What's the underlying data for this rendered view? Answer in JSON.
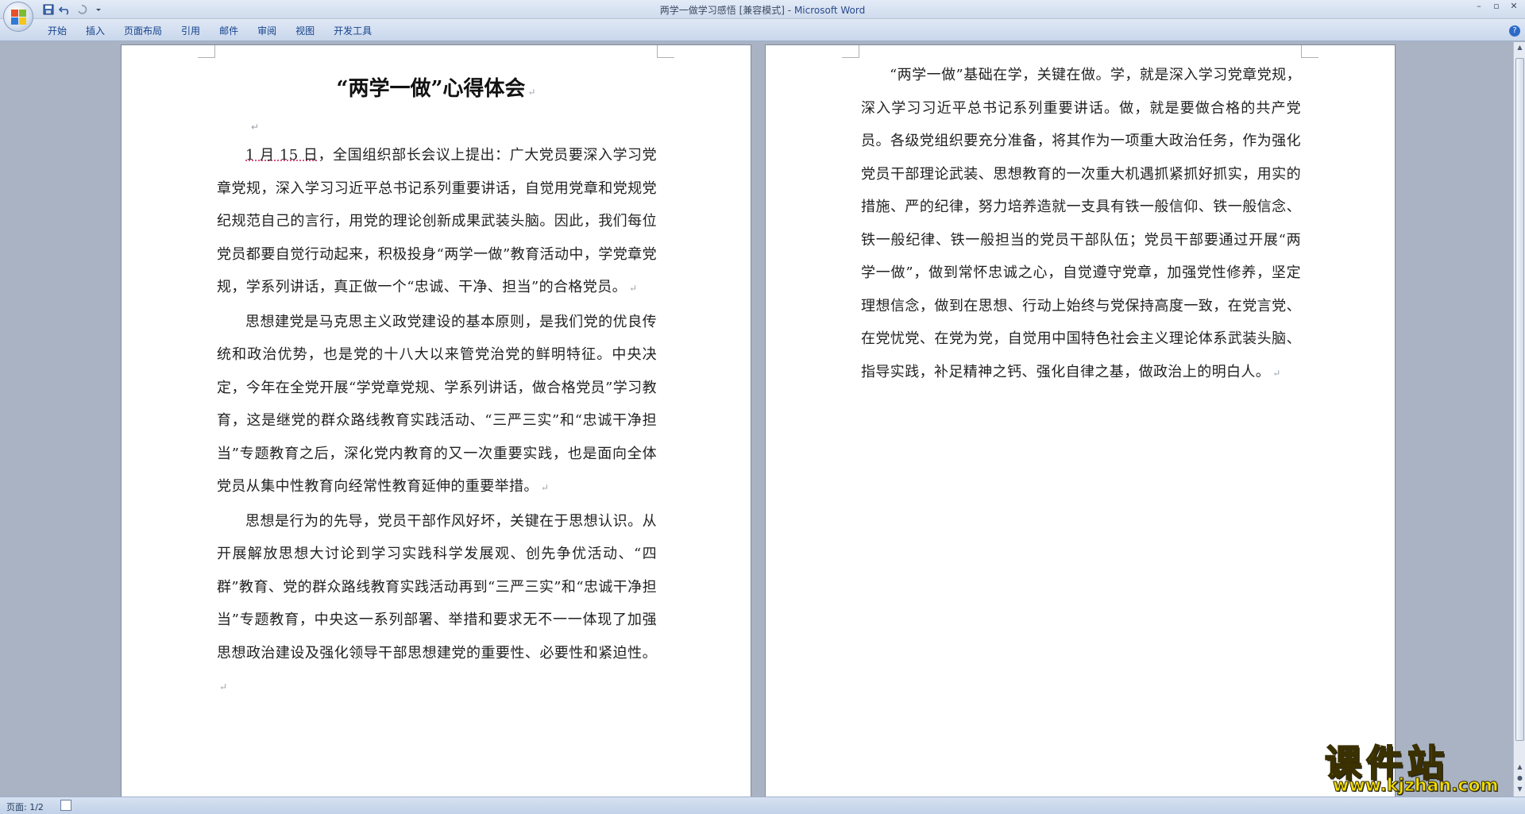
{
  "window": {
    "doc_title": "两学一做学习感悟 [兼容模式]",
    "separator": " - ",
    "app_name": "Microsoft Word",
    "controls": [
      "–",
      "▫",
      "✕"
    ]
  },
  "quick_access": {
    "icons": [
      "save-icon",
      "undo-icon",
      "redo-icon",
      "customize-icon"
    ]
  },
  "ribbon": {
    "tabs": [
      "开始",
      "插入",
      "页面布局",
      "引用",
      "邮件",
      "审阅",
      "视图",
      "开发工具"
    ],
    "help": "?"
  },
  "document": {
    "title": "“两学一做”心得体会",
    "paragraph_mark": "↵",
    "page1": {
      "p1_date": "1 月 15 日",
      "p1_rest": "，全国组织部长会议上提出：广大党员要深入学习党章党规，深入学习习近平总书记系列重要讲话，自觉用党章和党规党纪规范自己的言行，用党的理论创新成果武装头脑。因此，我们每位党员都要自觉行动起来，积极投身“两学一做”教育活动中，学党章党规，学系列讲话，真正做一个“忠诚、干净、担当”的合格党员。",
      "p2": "思想建党是马克思主义政党建设的基本原则，是我们党的优良传统和政治优势，也是党的十八大以来管党治党的鲜明特征。中央决定，今年在全党开展“学党章党规、学系列讲话，做合格党员”学习教育，这是继党的群众路线教育实践活动、“三严三实”和“忠诚干净担当”专题教育之后，深化党内教育的又一次重要实践，也是面向全体党员从集中性教育向经常性教育延伸的重要举措。",
      "p3": "思想是行为的先导，党员干部作风好坏，关键在于思想认识。从开展解放思想大讨论到学习实践科学发展观、创先争优活动、“四群”教育、党的群众路线教育实践活动再到“三严三实”和“忠诚干净担当”专题教育，中央这一系列部署、举措和要求无不一一体现了加强思想政治建设及强化领导干部思想建党的重要性、必要性和紧迫性。"
    },
    "page2": {
      "p1": "“两学一做”基础在学，关键在做。学，就是深入学习党章党规，深入学习习近平总书记系列重要讲话。做，就是要做合格的共产党员。各级党组织要充分准备，将其作为一项重大政治任务，作为强化党员干部理论武装、思想教育的一次重大机遇抓紧抓好抓实，用实的措施、严的纪律，努力培养造就一支具有铁一般信仰、铁一般信念、铁一般纪律、铁一般担当的党员干部队伍；党员干部要通过开展“两学一做”，做到常怀忠诚之心，自觉遵守党章，加强党性修养，坚定理想信念，做到在思想、行动上始终与党保持高度一致，在党言党、在党忧党、在党为党，自觉用中国特色社会主义理论体系武装头脑、指导实践，补足精神之钙、强化自律之基，做政治上的明白人。"
    }
  },
  "status": {
    "page_label": "页面: 1/2"
  },
  "watermark": {
    "title": "课件站",
    "url": "www.kjzhan.com"
  }
}
